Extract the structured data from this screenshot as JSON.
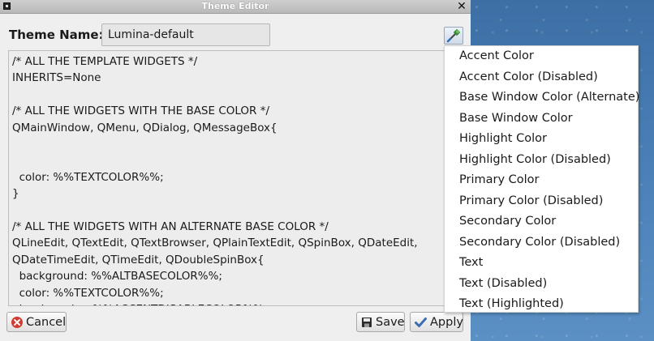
{
  "window": {
    "title": "Theme Editor",
    "close_glyph": "✕"
  },
  "form": {
    "theme_name_label": "Theme Name:",
    "theme_name_value": "Lumina-default"
  },
  "editor": {
    "text": "/* ALL THE TEMPLATE WIDGETS */\nINHERITS=None\n\n/* ALL THE WIDGETS WITH THE BASE COLOR */\nQMainWindow, QMenu, QDialog, QMessageBox{\n\n\n  color: %%TEXTCOLOR%%;\n}\n\n/* ALL THE WIDGETS WITH AN ALTERNATE BASE COLOR */\nQLineEdit, QTextEdit, QTextBrowser, QPlainTextEdit, QSpinBox, QDateEdit,\nQDateTimeEdit, QTimeEdit, QDoubleSpinBox{\n  background: %%ALTBASECOLOR%%;\n  color: %%TEXTCOLOR%%;\n  border-color: %%ACCENTDISABLECOLOR%%;"
  },
  "buttons": {
    "cancel": "Cancel",
    "save": "Save",
    "apply": "Apply"
  },
  "color_menu": {
    "items": [
      "Accent Color",
      "Accent Color (Disabled)",
      "Base Window Color (Alternate)",
      "Base Window Color",
      "Highlight Color",
      "Highlight Color (Disabled)",
      "Primary Color",
      "Primary Color (Disabled)",
      "Secondary Color",
      "Secondary Color (Disabled)",
      "Text",
      "Text (Disabled)",
      "Text (Highlighted)"
    ]
  },
  "icons": {
    "window_menu": "window-menu-icon",
    "close": "close-icon",
    "color_tool": "color-picker-icon",
    "cancel": "cancel-icon",
    "save": "save-icon",
    "apply": "checkmark-icon"
  },
  "colors": {
    "cancel_icon": "#d23b2f",
    "apply_icon": "#3b6fb0",
    "desktop": "#3f73a8"
  }
}
